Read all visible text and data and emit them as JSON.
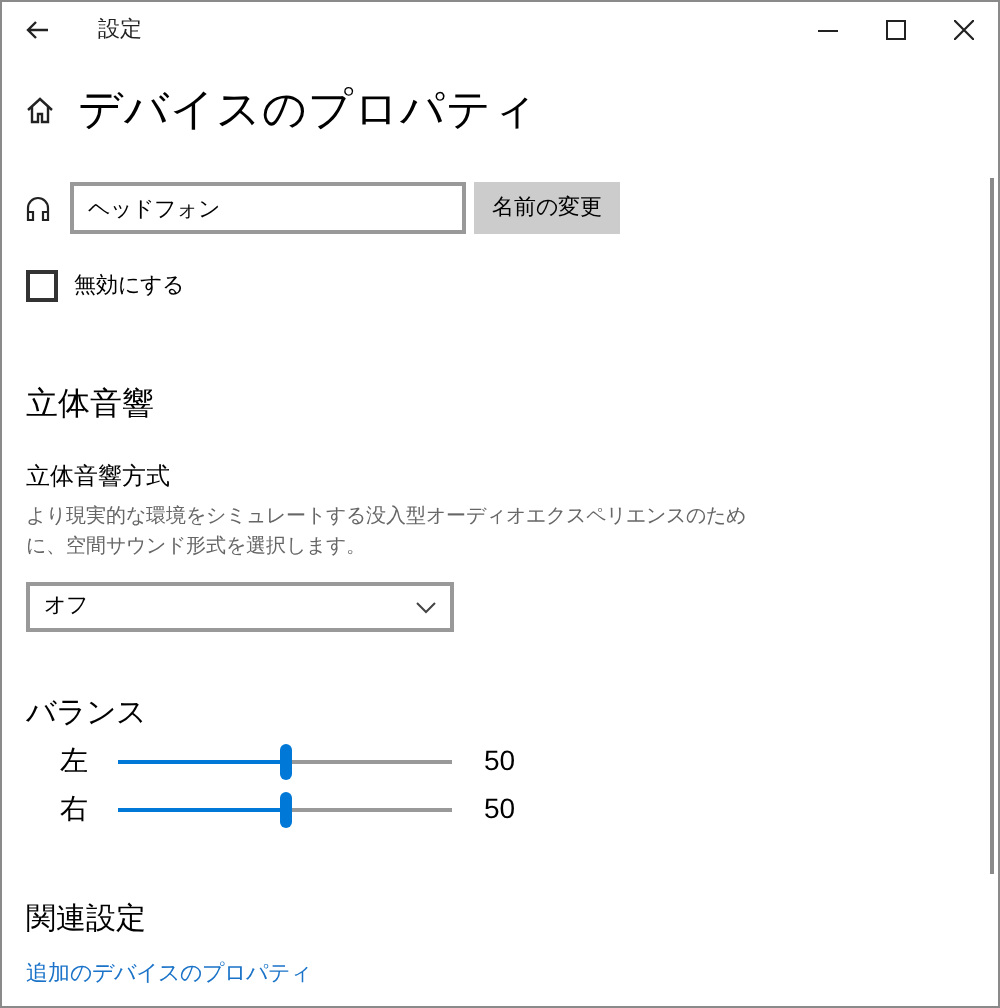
{
  "window": {
    "title": "設定"
  },
  "page": {
    "title": "デバイスのプロパティ"
  },
  "device_name": {
    "value": "ヘッドフォン"
  },
  "rename_button": "名前の変更",
  "disable": {
    "label": "無効にする",
    "checked": false
  },
  "spatial_sound": {
    "heading": "立体音響",
    "label": "立体音響方式",
    "description": "より現実的な環境をシミュレートする没入型オーディオエクスペリエンスのために、空間サウンド形式を選択します。",
    "dropdown": {
      "value": "オフ"
    }
  },
  "balance": {
    "heading": "バランス",
    "channels": [
      {
        "name": "左",
        "level": 0.5,
        "reading": "50"
      },
      {
        "name": "右",
        "level": 0.5,
        "reading": "50"
      }
    ]
  },
  "related": {
    "heading": "関連設定",
    "link": "追加のデバイスのプロパティ"
  }
}
